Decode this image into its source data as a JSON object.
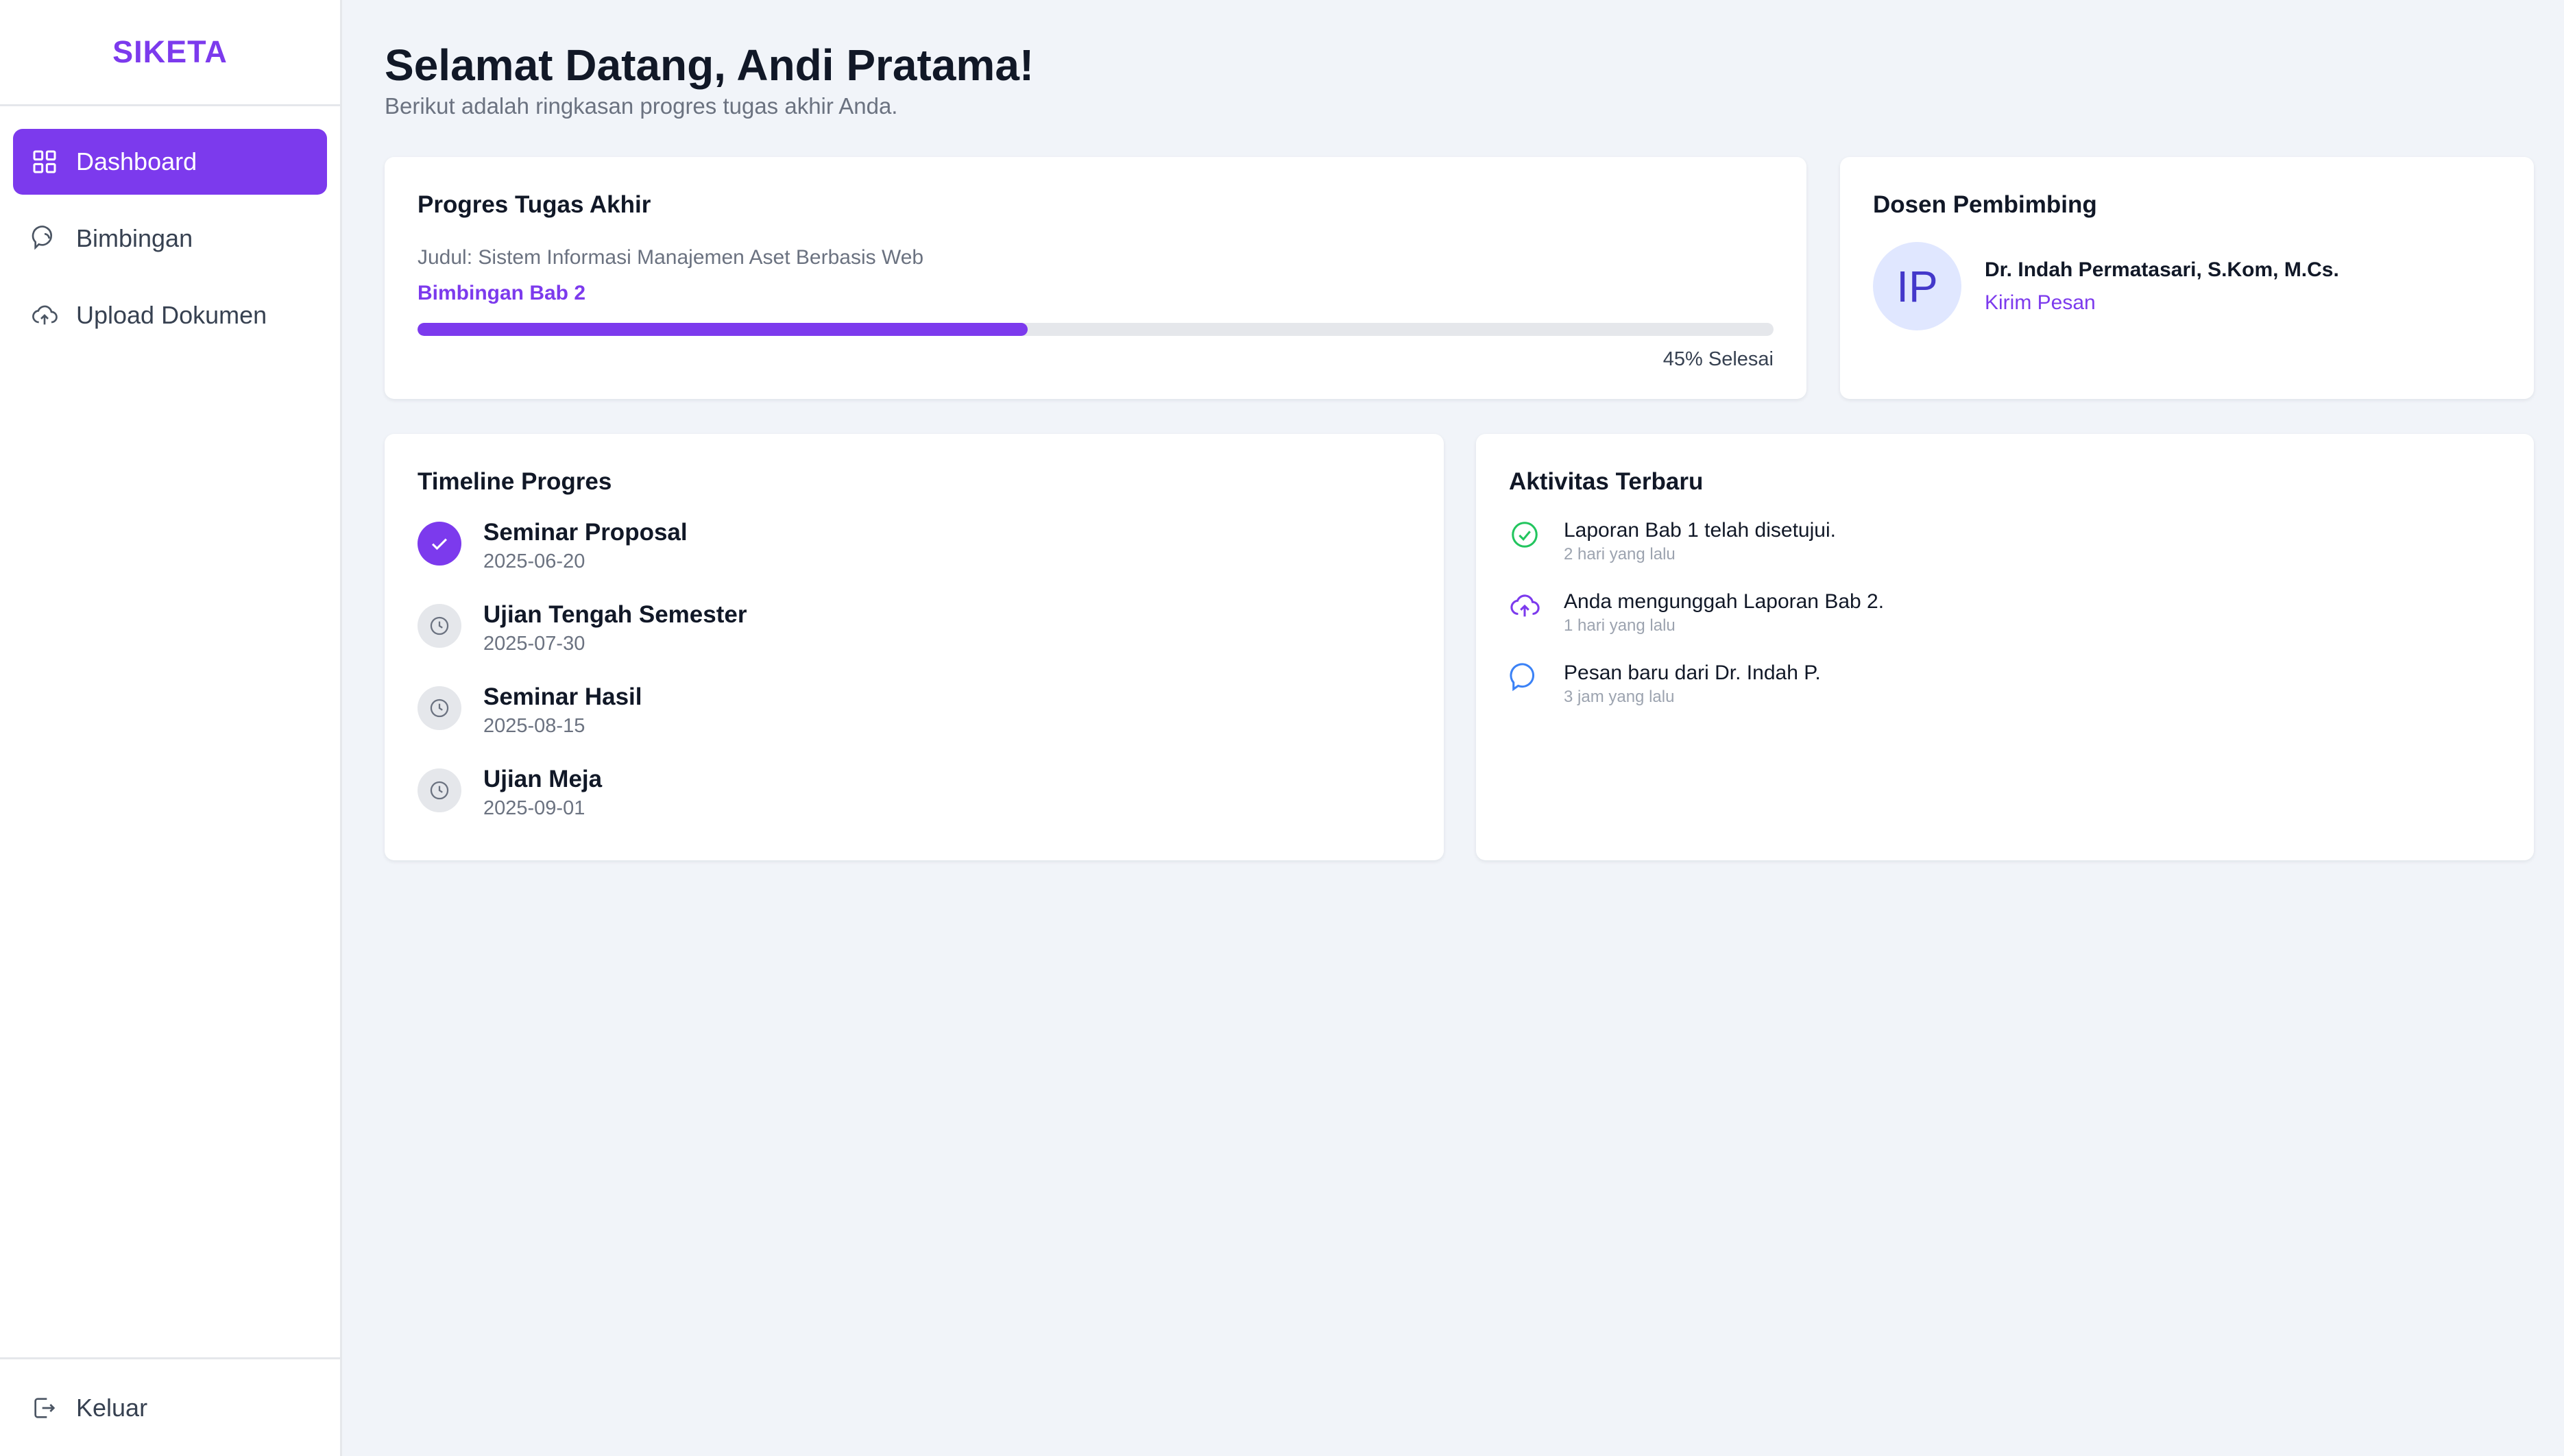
{
  "sidebar": {
    "brand": "SIKETA",
    "items": [
      {
        "label": "Dashboard",
        "icon": "grid-icon",
        "active": true
      },
      {
        "label": "Bimbingan",
        "icon": "chat-icon",
        "active": false
      },
      {
        "label": "Upload Dokumen",
        "icon": "cloud-upload-icon",
        "active": false
      }
    ],
    "logout_label": "Keluar"
  },
  "header": {
    "title": "Selamat Datang, Andi Pratama!",
    "subtitle": "Berikut adalah ringkasan progres tugas akhir Anda."
  },
  "progress": {
    "title": "Progres Tugas Akhir",
    "judul": "Judul: Sistem Informasi Manajemen Aset Berbasis Web",
    "stage": "Bimbingan Bab 2",
    "percent": 45,
    "percent_label": "45% Selesai"
  },
  "dosen": {
    "title": "Dosen Pembimbing",
    "initials": "IP",
    "name": "Dr. Indah Permatasari, S.Kom, M.Cs.",
    "link": "Kirim Pesan"
  },
  "timeline": {
    "title": "Timeline Progres",
    "items": [
      {
        "name": "Seminar Proposal",
        "date": "2025-06-20",
        "status": "done"
      },
      {
        "name": "Ujian Tengah Semester",
        "date": "2025-07-30",
        "status": "pending"
      },
      {
        "name": "Seminar Hasil",
        "date": "2025-08-15",
        "status": "pending"
      },
      {
        "name": "Ujian Meja",
        "date": "2025-09-01",
        "status": "pending"
      }
    ]
  },
  "activity": {
    "title": "Aktivitas Terbaru",
    "items": [
      {
        "text": "Laporan Bab 1 telah disetujui.",
        "time": "2 hari yang lalu",
        "icon": "check-circle-icon"
      },
      {
        "text": "Anda mengunggah Laporan Bab 2.",
        "time": "1 hari yang lalu",
        "icon": "cloud-upload-icon"
      },
      {
        "text": "Pesan baru dari Dr. Indah P.",
        "time": "3 jam yang lalu",
        "icon": "message-icon"
      }
    ]
  },
  "colors": {
    "accent": "#7c3aed",
    "background": "#f1f4f9",
    "success": "#22c55e",
    "info": "#3b82f6"
  }
}
